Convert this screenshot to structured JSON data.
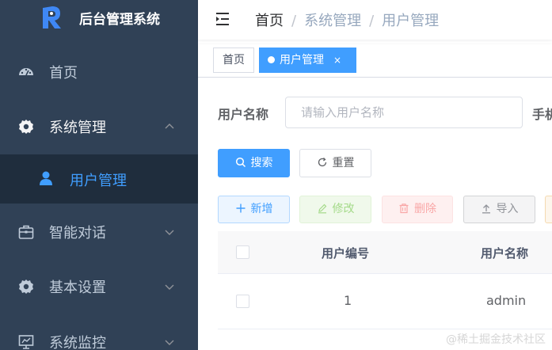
{
  "app": {
    "title": "后台管理系统"
  },
  "sidebar": {
    "items": [
      {
        "label": "首页",
        "icon": "dashboard-icon"
      },
      {
        "label": "系统管理",
        "icon": "gear-icon",
        "expanded": true,
        "children": [
          {
            "label": "用户管理",
            "icon": "user-icon",
            "active": true
          }
        ]
      },
      {
        "label": "智能对话",
        "icon": "briefcase-icon"
      },
      {
        "label": "基本设置",
        "icon": "gear-icon"
      },
      {
        "label": "系统监控",
        "icon": "monitor-icon"
      }
    ],
    "submenu_label": "用户管理"
  },
  "navbar": {
    "breadcrumb": [
      "首页",
      "系统管理",
      "用户管理"
    ],
    "separator": "/"
  },
  "tags": {
    "home": "首页",
    "active": "用户管理",
    "close": "×"
  },
  "search_form": {
    "username_label": "用户名称",
    "username_placeholder": "请输入用户名称",
    "phone_label": "手机"
  },
  "buttons": {
    "search": "搜索",
    "reset": "重置",
    "add": "新增",
    "edit": "修改",
    "delete": "删除",
    "import": "导入"
  },
  "table": {
    "columns": [
      "用户编号",
      "用户名称"
    ],
    "rows": [
      {
        "id": "1",
        "name": "admin"
      }
    ]
  },
  "watermark": "@稀土掘金技术社区",
  "colors": {
    "sidebar_bg": "#304156",
    "submenu_active_bg": "#1f2d3d",
    "primary": "#409eff",
    "menu_text": "#bfcbd9"
  }
}
